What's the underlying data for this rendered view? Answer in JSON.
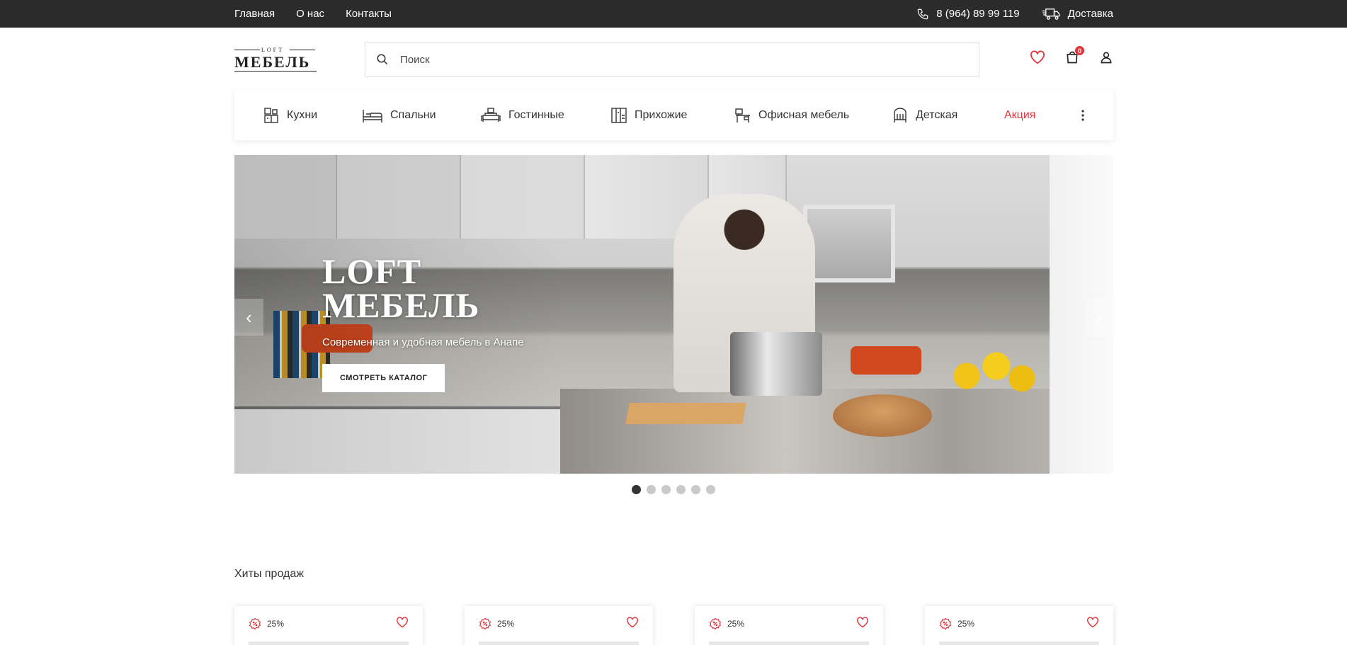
{
  "topbar": {
    "links": [
      "Главная",
      "О нас",
      "Контакты"
    ],
    "phone": "8 (964) 89 99 119",
    "delivery": "Доставка"
  },
  "header": {
    "logo_small": "LOFT",
    "logo_big": "МЕБЕЛЬ",
    "search_placeholder": "Поиск",
    "cart_count": "0"
  },
  "categories": [
    {
      "label": "Кухни",
      "icon": "kitchen-icon"
    },
    {
      "label": "Спальни",
      "icon": "bed-icon"
    },
    {
      "label": "Гостинные",
      "icon": "sofa-icon"
    },
    {
      "label": "Прихожие",
      "icon": "hallway-icon"
    },
    {
      "label": "Офисная мебель",
      "icon": "office-icon"
    },
    {
      "label": "Детская",
      "icon": "crib-icon"
    },
    {
      "label": "Акция",
      "icon": ""
    }
  ],
  "hero": {
    "title_line1": "LOFT",
    "title_line2": "МЕБЕЛЬ",
    "subtitle": "Современная и удобная мебель в Анапе",
    "button": "СМОТРЕТЬ КАТАЛОГ",
    "slides_total": 6,
    "active_slide": 1
  },
  "bestsellers": {
    "title": "Хиты продаж",
    "products": [
      {
        "discount": "25%"
      },
      {
        "discount": "25%"
      },
      {
        "discount": "25%"
      },
      {
        "discount": "25%"
      }
    ]
  },
  "colors": {
    "topbar": "#2b2b2b",
    "accent_red": "#e3343b"
  }
}
